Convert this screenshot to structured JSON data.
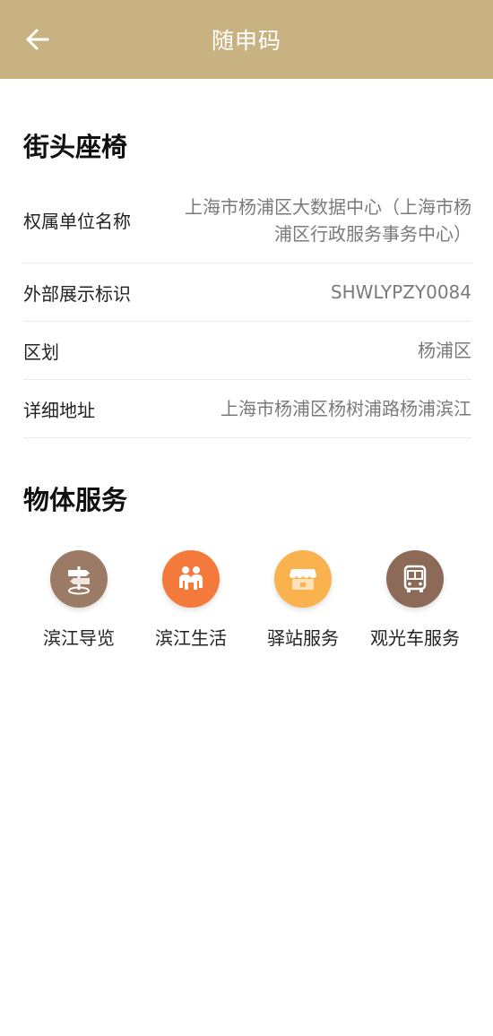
{
  "header": {
    "title": "随申码",
    "back_icon": "arrow-left-icon"
  },
  "object": {
    "title": "街头座椅",
    "fields": [
      {
        "label": "权属单位名称",
        "value_line1": "上海市杨浦区大数据中心（上海市杨",
        "value_line2": "浦区行政服务事务中心）"
      },
      {
        "label": "外部展示标识",
        "value": "SHWLYPZY0084"
      },
      {
        "label": "区划",
        "value": "杨浦区"
      },
      {
        "label": "详细地址",
        "value": "上海市杨浦区杨树浦路杨浦滨江"
      }
    ]
  },
  "services": {
    "title": "物体服务",
    "items": [
      {
        "label": "滨江导览",
        "icon": "signpost-icon",
        "color": "#9b7b66"
      },
      {
        "label": "滨江生活",
        "icon": "people-icon",
        "color": "#f47a3c"
      },
      {
        "label": "驿站服务",
        "icon": "store-icon",
        "color": "#f9b24d"
      },
      {
        "label": "观光车服务",
        "icon": "bus-icon",
        "color": "#8d6a58"
      }
    ]
  },
  "colors": {
    "header_bg": "#c9b282",
    "header_text": "#ffffff",
    "label_text": "#222222",
    "value_text": "#7a7a7a"
  }
}
